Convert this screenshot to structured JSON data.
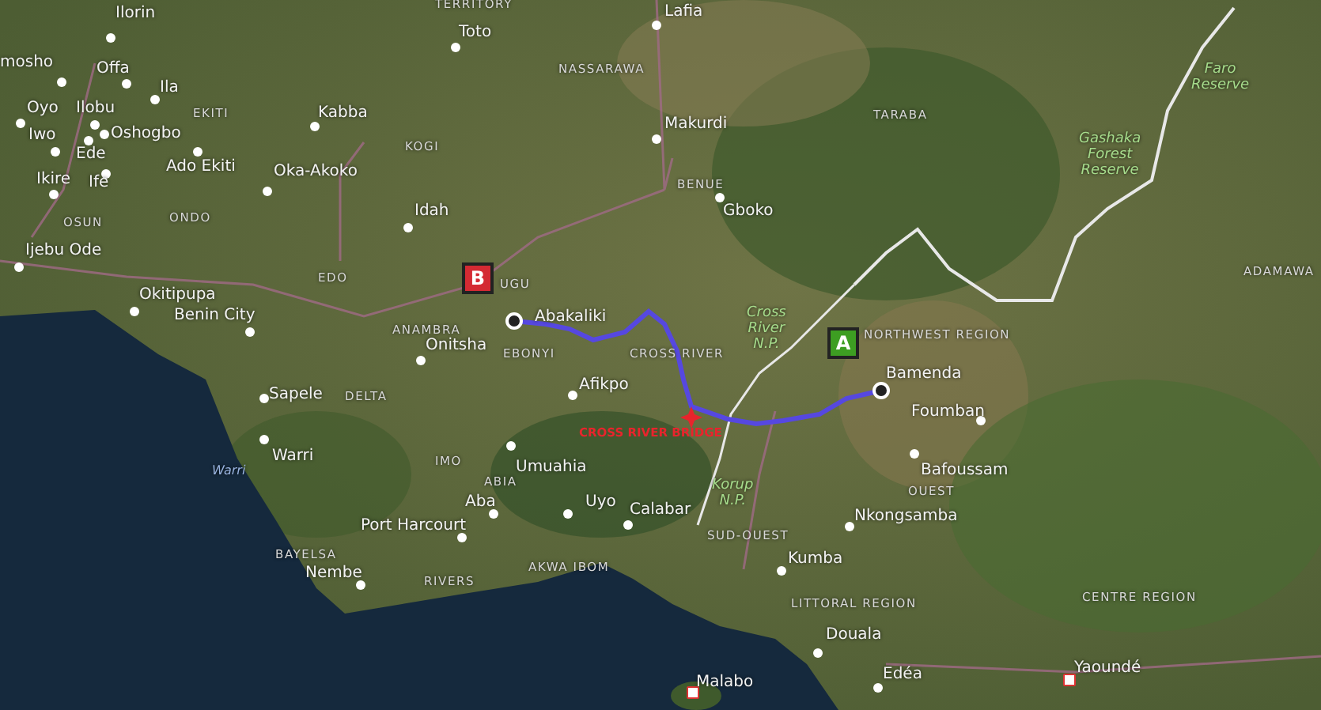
{
  "map": {
    "cities": [
      {
        "name": "Ilorin",
        "kind": "city"
      },
      {
        "name": "mosho",
        "kind": "city"
      },
      {
        "name": "Offa",
        "kind": "city"
      },
      {
        "name": "Ila",
        "kind": "city"
      },
      {
        "name": "Oyo",
        "kind": "city"
      },
      {
        "name": "Ilobu",
        "kind": "city"
      },
      {
        "name": "Iwo",
        "kind": "city"
      },
      {
        "name": "Oshogbo",
        "kind": "city"
      },
      {
        "name": "Ede",
        "kind": "city"
      },
      {
        "name": "Ikire",
        "kind": "city"
      },
      {
        "name": "Ife",
        "kind": "city"
      },
      {
        "name": "Ado Ekiti",
        "kind": "city"
      },
      {
        "name": "Kabba",
        "kind": "city"
      },
      {
        "name": "Oka-Akoko",
        "kind": "city"
      },
      {
        "name": "Idah",
        "kind": "city"
      },
      {
        "name": "Ijebu Ode",
        "kind": "city"
      },
      {
        "name": "Okitipupa",
        "kind": "city"
      },
      {
        "name": "Benin City",
        "kind": "city"
      },
      {
        "name": "Toto",
        "kind": "city"
      },
      {
        "name": "Lafia",
        "kind": "city"
      },
      {
        "name": "Makurdi",
        "kind": "city"
      },
      {
        "name": "Gboko",
        "kind": "city"
      },
      {
        "name": "Sapele",
        "kind": "city"
      },
      {
        "name": "Warri",
        "kind": "city"
      },
      {
        "name": "Port Harcourt",
        "kind": "city"
      },
      {
        "name": "Aba",
        "kind": "city"
      },
      {
        "name": "Umuahia",
        "kind": "city"
      },
      {
        "name": "Afikpo",
        "kind": "city"
      },
      {
        "name": "Uyo",
        "kind": "city"
      },
      {
        "name": "Calabar",
        "kind": "city"
      },
      {
        "name": "Nembe",
        "kind": "city"
      },
      {
        "name": "Onitsha",
        "kind": "city"
      },
      {
        "name": "Abakaliki",
        "kind": "city"
      },
      {
        "name": "Bamenda",
        "kind": "city"
      },
      {
        "name": "Foumban",
        "kind": "city"
      },
      {
        "name": "Bafoussam",
        "kind": "city"
      },
      {
        "name": "Nkongsamba",
        "kind": "city"
      },
      {
        "name": "Kumba",
        "kind": "city"
      },
      {
        "name": "Douala",
        "kind": "city"
      },
      {
        "name": "Edéa",
        "kind": "city"
      },
      {
        "name": "Yaoundé",
        "kind": "capital"
      },
      {
        "name": "Malabo",
        "kind": "capital"
      }
    ],
    "areas": [
      {
        "name": "TERRITORY",
        "kind": "region"
      },
      {
        "name": "NASSARAWA",
        "kind": "region"
      },
      {
        "name": "EKITI",
        "kind": "region"
      },
      {
        "name": "KOGI",
        "kind": "region"
      },
      {
        "name": "OSUN",
        "kind": "region"
      },
      {
        "name": "ONDO",
        "kind": "region"
      },
      {
        "name": "EDO",
        "kind": "region"
      },
      {
        "name": "UGU",
        "kind": "region"
      },
      {
        "name": "ANAMBRA",
        "kind": "region"
      },
      {
        "name": "EBONYI",
        "kind": "region"
      },
      {
        "name": "CROSS RIVER",
        "kind": "region"
      },
      {
        "name": "TARABA",
        "kind": "region"
      },
      {
        "name": "BENUE",
        "kind": "region"
      },
      {
        "name": "ADAMAWA",
        "kind": "region"
      },
      {
        "name": "NORTHWEST REGION",
        "kind": "region"
      },
      {
        "name": "DELTA",
        "kind": "region"
      },
      {
        "name": "IMO",
        "kind": "region"
      },
      {
        "name": "ABIA",
        "kind": "region"
      },
      {
        "name": "BAYELSA",
        "kind": "region"
      },
      {
        "name": "RIVERS",
        "kind": "region"
      },
      {
        "name": "AKWA IBOM",
        "kind": "region"
      },
      {
        "name": "SUD-OUEST",
        "kind": "region"
      },
      {
        "name": "OUEST",
        "kind": "region"
      },
      {
        "name": "LITTORAL REGION",
        "kind": "region"
      },
      {
        "name": "CENTRE REGION",
        "kind": "region"
      },
      {
        "name": "Faro\nReserve",
        "kind": "park"
      },
      {
        "name": "Gashaka\nForest\nReserve",
        "kind": "park"
      },
      {
        "name": "Cross\nRiver\nN.P.",
        "kind": "park"
      },
      {
        "name": "Korup\nN.P.",
        "kind": "park"
      },
      {
        "name": "Warri",
        "kind": "water"
      },
      {
        "name": "CROSS RIVER BRIDGE",
        "kind": "poi"
      }
    ],
    "markers": [
      {
        "label": "B",
        "color": "#d42a33"
      },
      {
        "label": "A",
        "color": "#3d9e22"
      }
    ]
  }
}
